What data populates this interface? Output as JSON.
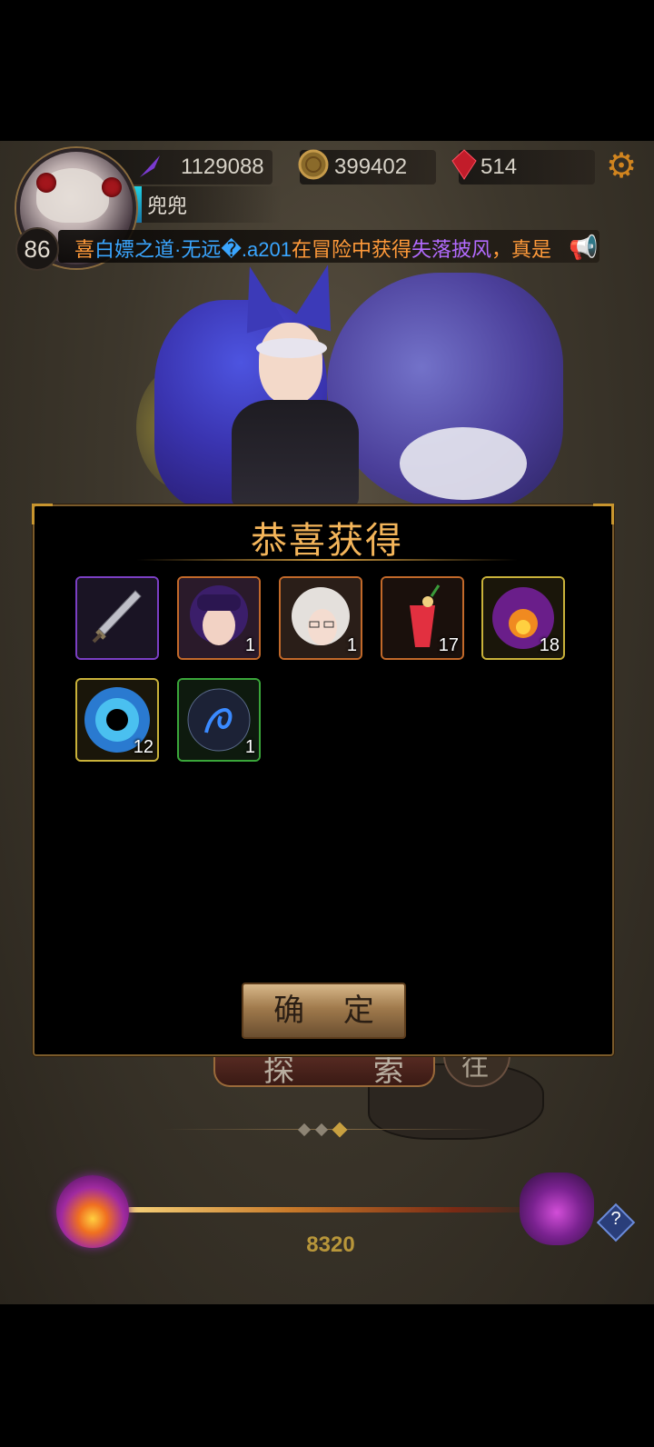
{
  "header": {
    "player_name": "兜兜",
    "level": "86",
    "resources": [
      {
        "icon": "purple-feather-icon",
        "value": "1129088"
      },
      {
        "icon": "gold-coin-icon",
        "value": "399402"
      },
      {
        "icon": "red-crystal-icon",
        "value": "514"
      }
    ],
    "settings_icon": "gear-icon"
  },
  "ticker": {
    "segments": [
      {
        "text": "喜",
        "color": "#ff9a3a"
      },
      {
        "text": "白嫖之道·无远�.a201",
        "color": "#3aa6ff"
      },
      {
        "text": "在冒险中获得",
        "color": "#ff9a3a"
      },
      {
        "text": "失落披风",
        "color": "#b36bff"
      },
      {
        "text": "，真是",
        "color": "#ff9a3a"
      }
    ],
    "icon": "megaphone-icon"
  },
  "dialog": {
    "title": "恭喜获得",
    "confirm_label": "确 定",
    "items": [
      {
        "icon": "sword-icon",
        "count": "",
        "rarity_color": "#7b3fc4"
      },
      {
        "icon": "purple-hair-character-icon",
        "count": "1",
        "rarity_color": "#c2692a"
      },
      {
        "icon": "silver-hair-character-icon",
        "count": "1",
        "rarity_color": "#c2692a"
      },
      {
        "icon": "red-drink-icon",
        "count": "17",
        "rarity_color": "#c2692a"
      },
      {
        "icon": "purple-fire-orb-icon",
        "count": "18",
        "rarity_color": "#c9b23a"
      },
      {
        "icon": "blue-vortex-orb-icon",
        "count": "12",
        "rarity_color": "#c9b23a"
      },
      {
        "icon": "blue-rune-orb-icon",
        "count": "1",
        "rarity_color": "#3aa63a"
      }
    ]
  },
  "bottom": {
    "explore_label": "探 索",
    "side_button_label": "往",
    "score": "8320",
    "fire_orb_icon": "fire-orb-icon",
    "demon_icon": "demon-mask-icon",
    "help_label": "?"
  }
}
